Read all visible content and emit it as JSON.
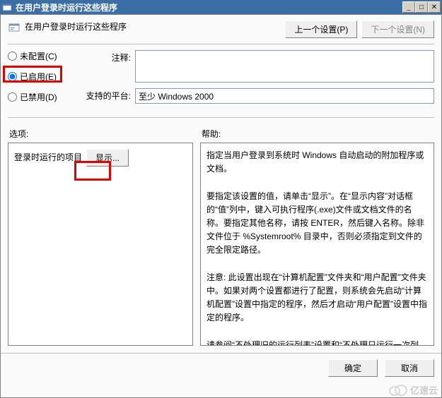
{
  "title": "在用户登录时运行这些程序",
  "header_title": "在用户登录时运行这些程序",
  "nav": {
    "prev": "上一个设置(P)",
    "next": "下一个设置(N)"
  },
  "radios": {
    "not_configured": "未配置(C)",
    "enabled": "已启用(E)",
    "disabled": "已禁用(D)"
  },
  "labels": {
    "comment": "注释:",
    "platform": "支持的平台:",
    "options": "选项:",
    "help": "帮助:"
  },
  "platform_value": "至少 Windows 2000",
  "left_item_label": "登录时运行的项目",
  "show_button": "显示...",
  "help_text_1": "指定当用户登录到系统时 Windows 自动启动的附加程序或文档。",
  "help_text_2": "要指定该设置的值，请单击“显示”。在“显示内容”对话框的“值”列中，键入可执行程序(.exe)文件或文档文件的名称。要指定其他名称，请按 ENTER，然后键入名称。除非文件位于 %Systemroot% 目录中，否则必须指定到文件的完全限定路径。",
  "help_text_3": "注意: 此设置出现在“计算机配置”文件夹和“用户配置”文件夹中。如果对两个设置都进行了配置，则系统会先启动“计算机配置”设置中指定的程序，然后才启动“用户配置”设置中指定的程序。",
  "help_text_4": "请参阅“不处理旧的运行列表”设置和“不处理只运行一次列表”设置。",
  "footer": {
    "ok": "确定",
    "cancel": "取消"
  },
  "watermark": "亿速云"
}
